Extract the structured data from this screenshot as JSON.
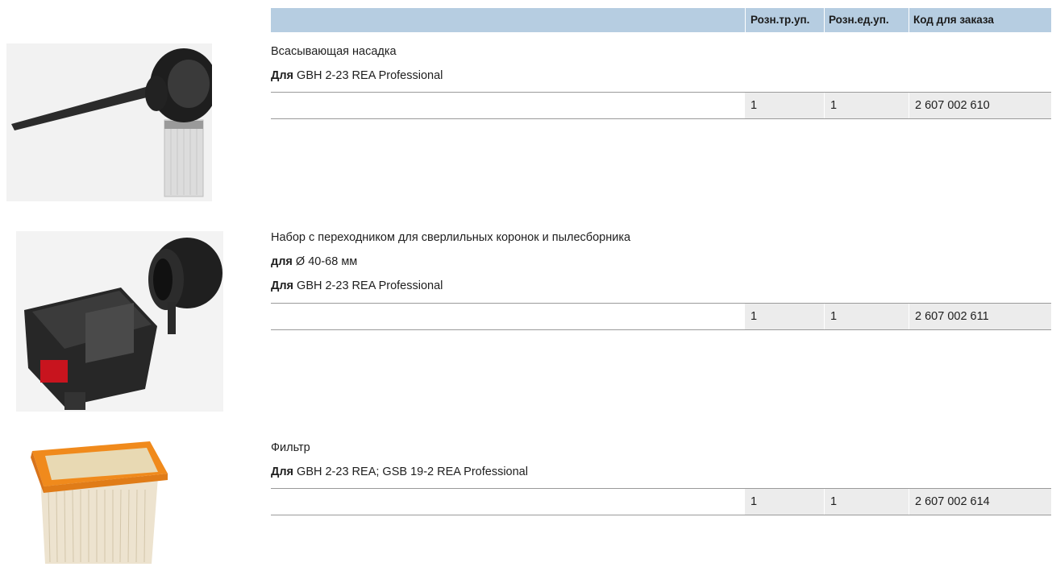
{
  "table_header": {
    "col1": "Розн.тр.уп.",
    "col2": "Розн.ед.уп.",
    "col3": "Код для заказа"
  },
  "products": [
    {
      "name": "Всасывающая насадка",
      "spec_lines": [
        {
          "label": "Для",
          "value": "GBH 2-23 REA Professional"
        }
      ],
      "retail_pack": "1",
      "retail_unit": "1",
      "order_code": "2 607 002 610",
      "image": "suction-nozzle-image"
    },
    {
      "name": "Набор с переходником для сверлильных коронок и пылесборника",
      "spec_lines": [
        {
          "label": "для",
          "value": "Ø 40-68 мм"
        },
        {
          "label": "Для",
          "value": "GBH 2-23 REA Professional"
        }
      ],
      "retail_pack": "1",
      "retail_unit": "1",
      "order_code": "2 607 002 611",
      "image": "adapter-set-image"
    },
    {
      "name": "Фильтр",
      "spec_lines": [
        {
          "label": "Для",
          "value": "GBH 2-23 REA; GSB 19-2 REA Professional"
        }
      ],
      "retail_pack": "1",
      "retail_unit": "1",
      "order_code": "2 607 002 614",
      "image": "filter-image"
    }
  ]
}
